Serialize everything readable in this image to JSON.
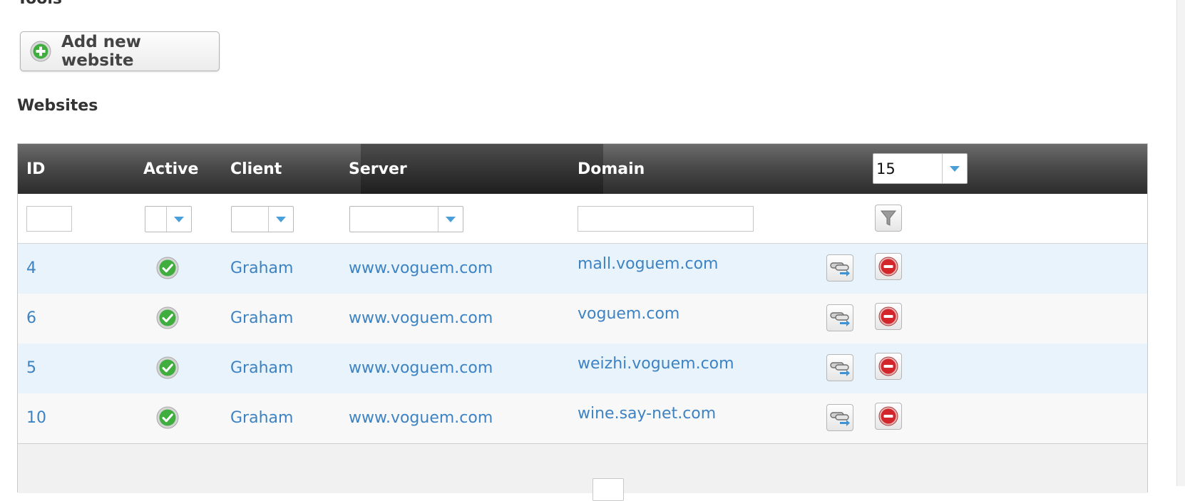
{
  "page": {
    "tools_heading": "Tools",
    "add_button_label": "Add new website",
    "section_heading": "Websites"
  },
  "table": {
    "columns": {
      "id": "ID",
      "active": "Active",
      "client": "Client",
      "server": "Server",
      "domain": "Domain"
    },
    "page_size": "15",
    "filters": {
      "id": "",
      "active": "",
      "client": "",
      "server": "",
      "domain": ""
    },
    "rows": [
      {
        "id": "4",
        "active": true,
        "client": "Graham",
        "server": "www.voguem.com",
        "domain": "mall.voguem.com"
      },
      {
        "id": "6",
        "active": true,
        "client": "Graham",
        "server": "www.voguem.com",
        "domain": "voguem.com"
      },
      {
        "id": "5",
        "active": true,
        "client": "Graham",
        "server": "www.voguem.com",
        "domain": "weizhi.voguem.com"
      },
      {
        "id": "10",
        "active": true,
        "client": "Graham",
        "server": "www.voguem.com",
        "domain": "wine.say-net.com"
      }
    ]
  },
  "icons": {
    "add": "plus-circle-icon",
    "active": "check-circle-icon",
    "edit": "link-edit-icon",
    "delete": "delete-icon",
    "filter": "funnel-icon",
    "dropdown": "chevron-down-icon"
  },
  "colors": {
    "link": "#3d83c3",
    "header_dark": "#2c2c2c",
    "row_alt": "#e9f3fb",
    "success_green": "#3fae3f",
    "delete_red": "#d2262b",
    "dropdown_blue": "#4a9fd8"
  }
}
